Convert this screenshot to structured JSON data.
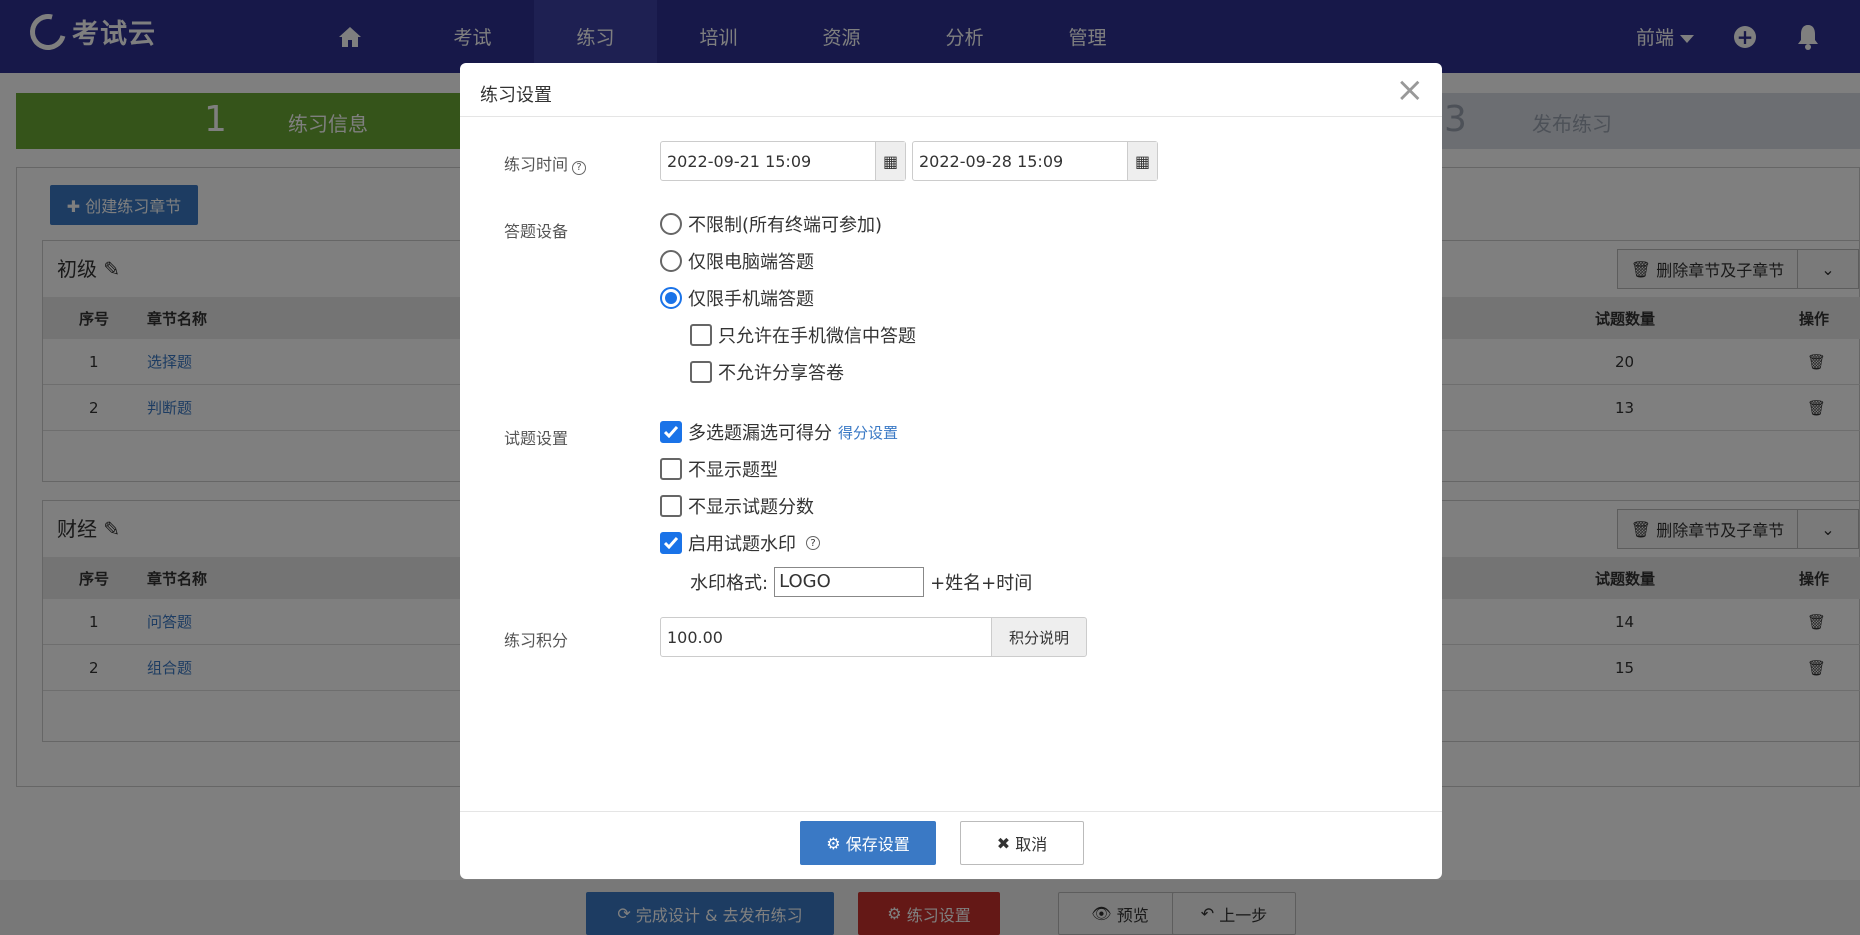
{
  "topbar": {
    "logo_text": "考试云",
    "nav": [
      "考试",
      "练习",
      "培训",
      "资源",
      "分析",
      "管理"
    ],
    "active": "练习",
    "user": "前端"
  },
  "steps": {
    "step1_num": "1",
    "step1_label": "练习信息",
    "step3_num": "3",
    "step3_label": "发布练习"
  },
  "page": {
    "create_btn": "✚ 创建练习章节",
    "sections": [
      {
        "title": "初级",
        "delete_btn": "删除章节及子章节",
        "headers": {
          "no": "序号",
          "name": "章节名称",
          "count": "试题数量",
          "op": "操作"
        },
        "rows": [
          {
            "no": "1",
            "name": "选择题",
            "count": "20"
          },
          {
            "no": "2",
            "name": "判断题",
            "count": "13"
          }
        ]
      },
      {
        "title": "财经",
        "delete_btn": "删除章节及子章节",
        "headers": {
          "no": "序号",
          "name": "章节名称",
          "count": "试题数量",
          "op": "操作"
        },
        "rows": [
          {
            "no": "1",
            "name": "问答题",
            "count": "14"
          },
          {
            "no": "2",
            "name": "组合题",
            "count": "15"
          }
        ]
      }
    ]
  },
  "bottom": {
    "finish": "完成设计 & 去发布练习",
    "settings": "练习设置",
    "preview": "预览",
    "prev": "上一步"
  },
  "modal": {
    "title": "练习设置",
    "time_label": "练习时间",
    "start_time": "2022-09-21 15:09",
    "end_time": "2022-09-28 15:09",
    "device_label": "答题设备",
    "device_options": [
      "不限制(所有终端可参加)",
      "仅限电脑端答题",
      "仅限手机端答题"
    ],
    "device_selected": 2,
    "mobile_options": [
      "只允许在手机微信中答题",
      "不允许分享答卷"
    ],
    "question_label": "试题设置",
    "question_options": [
      "多选题漏选可得分",
      "不显示题型",
      "不显示试题分数",
      "启用试题水印"
    ],
    "score_setting_link": "得分设置",
    "watermark_label": "水印格式:",
    "watermark_value": "LOGO",
    "watermark_suffix": "+姓名+时间",
    "points_label": "练习积分",
    "points_value": "100.00",
    "points_help": "积分说明",
    "save": "保存设置",
    "cancel": "取消"
  }
}
